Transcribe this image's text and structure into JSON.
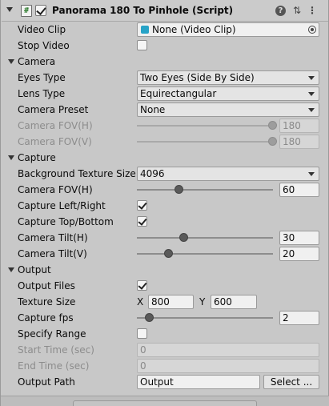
{
  "header": {
    "script_icon": "script-hash-icon",
    "title": "Panorama 180 To Pinhole (Script)",
    "help_glyph": "?",
    "settings_glyph": "⇅",
    "menu_glyph": "⋮"
  },
  "rows": {
    "video_clip": {
      "label": "Video Clip",
      "value": "None (Video Clip)"
    },
    "stop_video": {
      "label": "Stop Video",
      "checked": false
    },
    "camera_section": "Camera",
    "eyes_type": {
      "label": "Eyes Type",
      "value": "Two Eyes (Side By Side)"
    },
    "lens_type": {
      "label": "Lens Type",
      "value": "Equirectangular"
    },
    "camera_preset": {
      "label": "Camera Preset",
      "value": "None"
    },
    "camera_fov_h_disabled": {
      "label": "Camera FOV(H)",
      "value": "180",
      "slider_fraction": 1.0
    },
    "camera_fov_v_disabled": {
      "label": "Camera FOV(V)",
      "value": "180",
      "slider_fraction": 1.0
    },
    "capture_section": "Capture",
    "bg_texture_size": {
      "label": "Background Texture Size",
      "value": "4096"
    },
    "capture_fov_h": {
      "label": "Camera FOV(H)",
      "value": "60",
      "slider_fraction": 0.31
    },
    "capture_left_right": {
      "label": "Capture Left/Right",
      "checked": true
    },
    "capture_top_bottom": {
      "label": "Capture Top/Bottom",
      "checked": true
    },
    "camera_tilt_h": {
      "label": "Camera Tilt(H)",
      "value": "30",
      "slider_fraction": 0.35
    },
    "camera_tilt_v": {
      "label": "Camera Tilt(V)",
      "value": "20",
      "slider_fraction": 0.24
    },
    "output_section": "Output",
    "output_files": {
      "label": "Output Files",
      "checked": true
    },
    "texture_size": {
      "label": "Texture Size",
      "x_label": "X",
      "x_value": "800",
      "y_label": "Y",
      "y_value": "600"
    },
    "capture_fps": {
      "label": "Capture fps",
      "value": "2",
      "slider_fraction": 0.08
    },
    "specify_range": {
      "label": "Specify Range",
      "checked": false
    },
    "start_time": {
      "label": "Start Time (sec)",
      "value": "0"
    },
    "end_time": {
      "label": "End Time (sec)",
      "value": "0"
    },
    "output_path": {
      "label": "Output Path",
      "value": "Output",
      "button_label": "Select ..."
    }
  }
}
